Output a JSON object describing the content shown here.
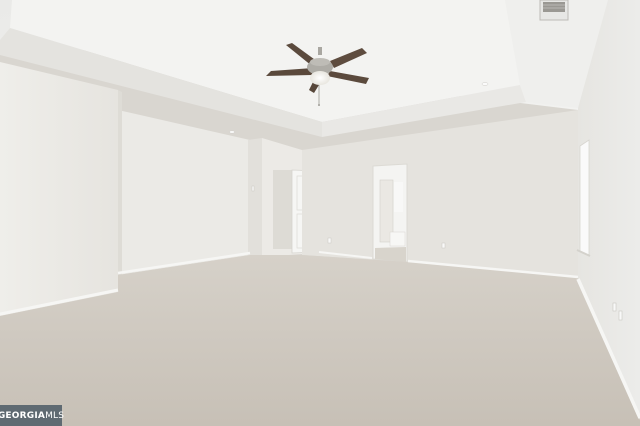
{
  "photo": {
    "watermark": {
      "brand": "GEORGIA",
      "suffix": "MLS"
    },
    "colors": {
      "ceiling": "#ededeb",
      "tray": "#f4f4f2",
      "wall_left": "#ebeae6",
      "wall_back": "#e6e4df",
      "wall_right": "#e9e8e4",
      "carpet": "#cfc9c0",
      "baseboard": "#f7f7f5",
      "fan_blade": "#5e4c3f",
      "fan_metal": "#a7a59f"
    },
    "icons": [
      "ceiling-fan-icon",
      "air-vent-icon",
      "smoke-detector-icon"
    ]
  }
}
